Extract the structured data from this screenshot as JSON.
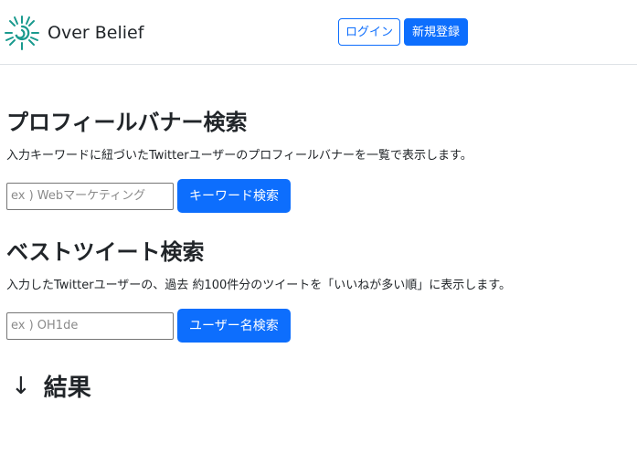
{
  "navbar": {
    "brand_name": "Over Belief",
    "logo_icon": "sun-swirl-logo-icon",
    "brand_color": "#1a9a8e",
    "login_label": "ログイン",
    "signup_label": "新規登録"
  },
  "banner_search": {
    "title": "プロフィールバナー検索",
    "description": "入力キーワードに紐づいたTwitterユーザーのプロフィールバナーを一覧で表示します。",
    "placeholder": "ex ) Webマーケティング",
    "button_label": "キーワード検索"
  },
  "tweet_search": {
    "title": "ベストツイート検索",
    "description": "入力したTwitterユーザーの、過去 約100件分のツイートを「いいねが多い順」に表示します。",
    "placeholder": "ex ) OH1de",
    "button_label": "ユーザー名検索"
  },
  "results": {
    "arrow": "↓",
    "title": "結果"
  },
  "colors": {
    "primary": "#0d6efd",
    "text": "#212529",
    "border": "#dee2e6"
  }
}
